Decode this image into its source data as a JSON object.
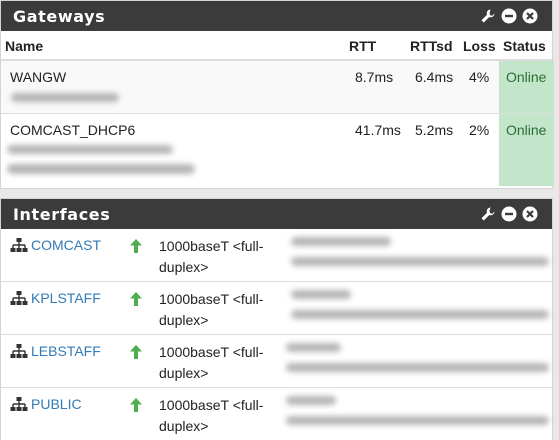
{
  "gateways": {
    "title": "Gateways",
    "columns": {
      "name": "Name",
      "rtt": "RTT",
      "rttsd": "RTTsd",
      "loss": "Loss",
      "status": "Status"
    },
    "rows": [
      {
        "name": "WANGW",
        "rtt": "8.7ms",
        "rttsd": "6.4ms",
        "loss": "4%",
        "status": "Online"
      },
      {
        "name": "COMCAST_DHCP6",
        "rtt": "41.7ms",
        "rttsd": "5.2ms",
        "loss": "2%",
        "status": "Online"
      }
    ]
  },
  "interfaces": {
    "title": "Interfaces",
    "rows": [
      {
        "name": "COMCAST",
        "media": "1000baseT <full-duplex>"
      },
      {
        "name": "KPLSTAFF",
        "media": "1000baseT <full-duplex>"
      },
      {
        "name": "LEBSTAFF",
        "media": "1000baseT <full-duplex>"
      },
      {
        "name": "PUBLIC",
        "media": "1000baseT <full-duplex>"
      }
    ]
  },
  "icons": {
    "settings": "wrench-icon",
    "minimize": "minus-circle-icon",
    "close": "close-circle-icon",
    "network": "sitemap-icon",
    "status_up": "arrow-up-icon"
  },
  "colors": {
    "header_bg": "#3b3b3b",
    "online_bg": "#c3e6cb",
    "online_text": "#2c6e36",
    "link": "#337ab7",
    "up_arrow": "#4cae4c"
  }
}
